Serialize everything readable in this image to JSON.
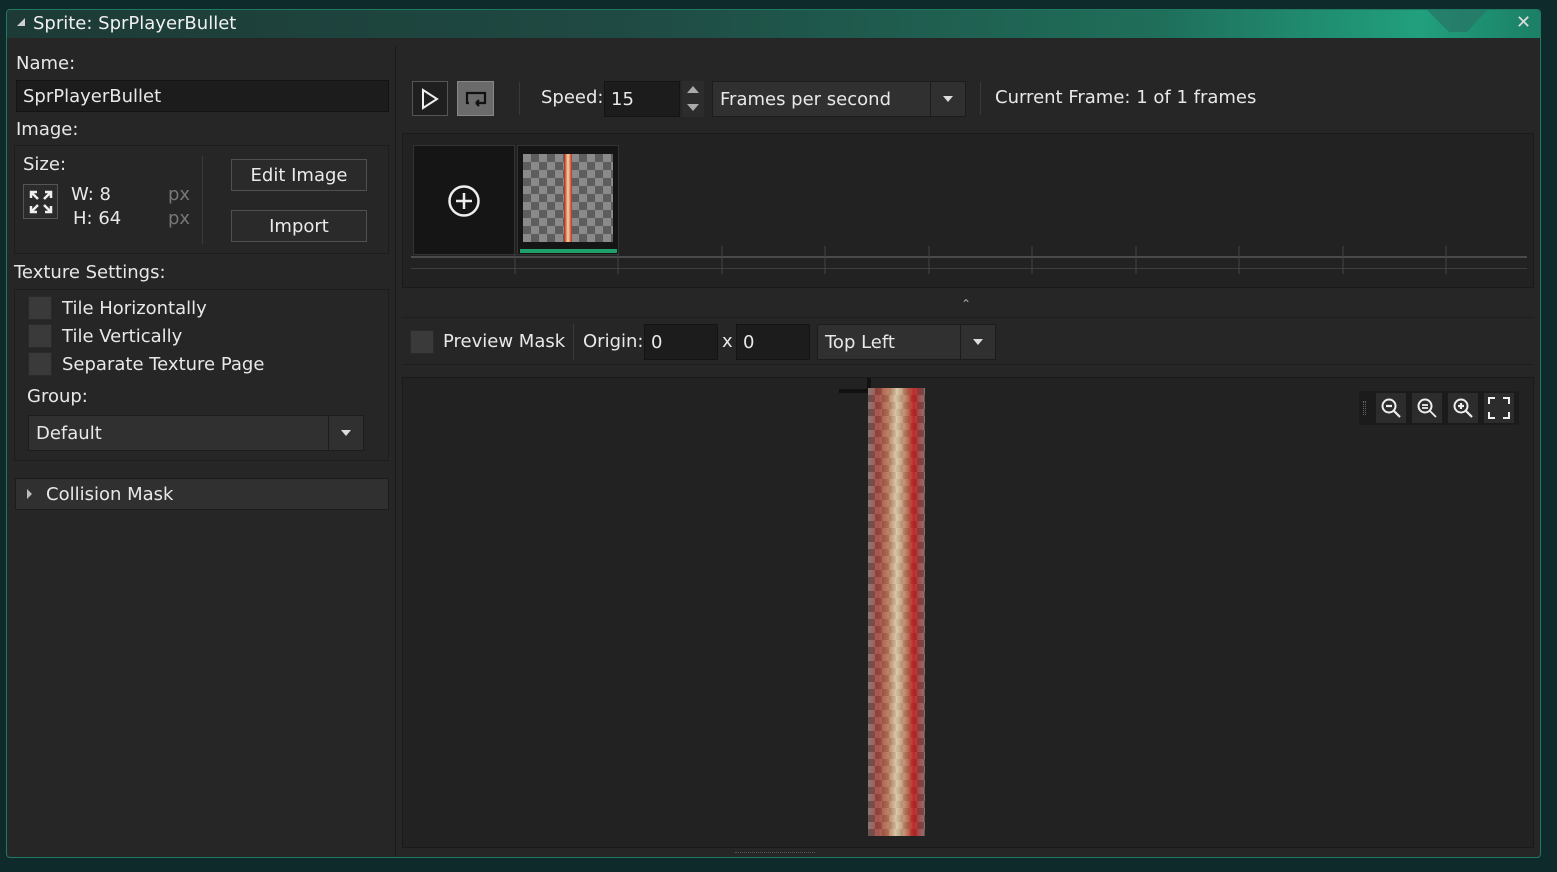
{
  "window": {
    "title": "Sprite: SprPlayerBullet"
  },
  "left": {
    "name_label": "Name:",
    "name_value": "SprPlayerBullet",
    "image_label": "Image:",
    "size_label": "Size:",
    "width_text": "W: 8",
    "height_text": "H: 64",
    "unit": "px",
    "edit_image_label": "Edit Image",
    "import_label": "Import",
    "texture_settings_label": "Texture Settings:",
    "tile_horizontally": "Tile Horizontally",
    "tile_vertically": "Tile Vertically",
    "separate_texture_page": "Separate Texture Page",
    "group_label": "Group:",
    "group_value": "Default",
    "collision_mask_label": "Collision Mask"
  },
  "toolbar": {
    "speed_label": "Speed:",
    "speed_value": "15",
    "speed_mode": "Frames per second",
    "current_frame_text": "Current Frame: 1 of 1 frames"
  },
  "mask_bar": {
    "preview_mask_label": "Preview Mask",
    "origin_label": "Origin:",
    "origin_x": "0",
    "origin_sep": "x",
    "origin_y": "0",
    "origin_preset": "Top Left"
  },
  "colors": {
    "accent": "#21a07e",
    "frame_selected": "#1fa06a",
    "bullet_red": "#c0281a",
    "bullet_core": "#f3e2b8"
  }
}
